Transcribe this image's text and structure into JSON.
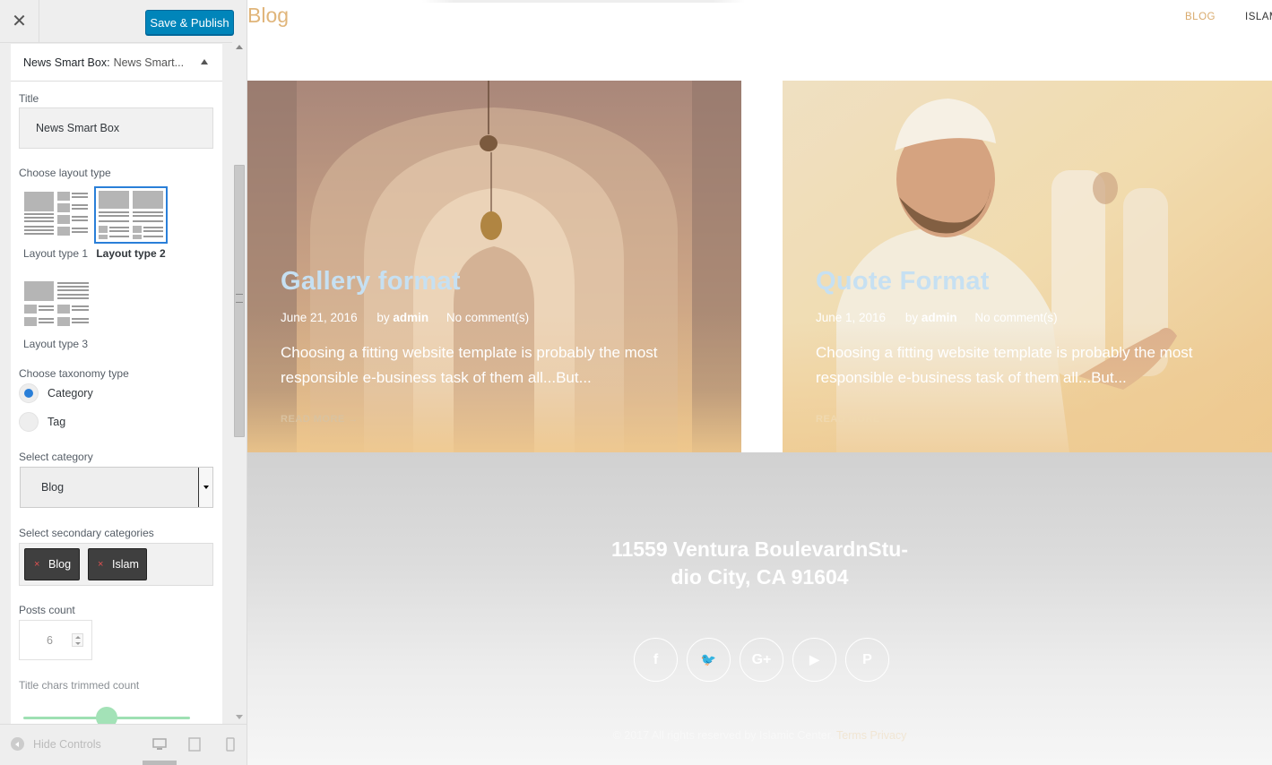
{
  "header": {
    "close_symbol": "✕",
    "publish_label": "Save & Publish"
  },
  "section": {
    "name": "News Smart Box:",
    "subtitle": "News Smart..."
  },
  "fields": {
    "title_label": "Title",
    "title_value": "News Smart Box",
    "layout_label": "Choose layout type",
    "layouts": [
      {
        "label": "Layout type 1",
        "selected": false
      },
      {
        "label": "Layout type 2",
        "selected": true
      },
      {
        "label": "Layout type 3",
        "selected": false
      }
    ],
    "taxonomy_label": "Choose taxonomy type",
    "taxonomy_options": [
      {
        "label": "Category",
        "checked": true
      },
      {
        "label": "Tag",
        "checked": false
      }
    ],
    "category_label": "Select category",
    "category_value": "Blog",
    "secondary_label": "Select secondary categories",
    "secondary_tags": [
      "Blog",
      "Islam"
    ],
    "tag_remove_symbol": "×",
    "posts_count_label": "Posts count",
    "posts_count_value": "6",
    "title_chars_label": "Title chars trimmed count"
  },
  "footer_controls": {
    "hide_label": "Hide Controls",
    "devices": [
      "desktop-icon",
      "tablet-icon",
      "mobile-icon"
    ]
  },
  "preview": {
    "logo": "Blog",
    "nav": [
      "BLOG",
      "ISLAM"
    ],
    "cards": [
      {
        "title": "Gallery format",
        "date": "June 21, 2016",
        "by": "by",
        "author": "admin",
        "comments": "No comment(s)",
        "excerpt": "Choosing a fitting website template is probably the most responsible e-business task of them all...But...",
        "more": "READ MORE →"
      },
      {
        "title": "Quote Format",
        "date": "June 1, 2016",
        "by": "by",
        "author": "admin",
        "comments": "No comment(s)",
        "excerpt": "Choosing a fitting website template is probably the most responsible e-business task of them all...But...",
        "more": "READ MORE →"
      }
    ],
    "footer": {
      "address_line1": "11559 Ventura BoulevardnStu-",
      "address_line2": "dio City, CA 91604",
      "socials": [
        {
          "name": "facebook-icon",
          "glyph": "f"
        },
        {
          "name": "twitter-icon",
          "glyph": "🐦"
        },
        {
          "name": "google-plus-icon",
          "glyph": "G+"
        },
        {
          "name": "youtube-icon",
          "glyph": "▶"
        },
        {
          "name": "pinterest-icon",
          "glyph": "P"
        }
      ],
      "copyright": "© 2017 All rights reserved by Islamic Center.",
      "terms": "Terms Privacy"
    }
  },
  "colors": {
    "publish": "#0085ba",
    "accent": "#2a7fd8",
    "logo": "#e0b57a",
    "card_title": "#c6e0f2"
  }
}
